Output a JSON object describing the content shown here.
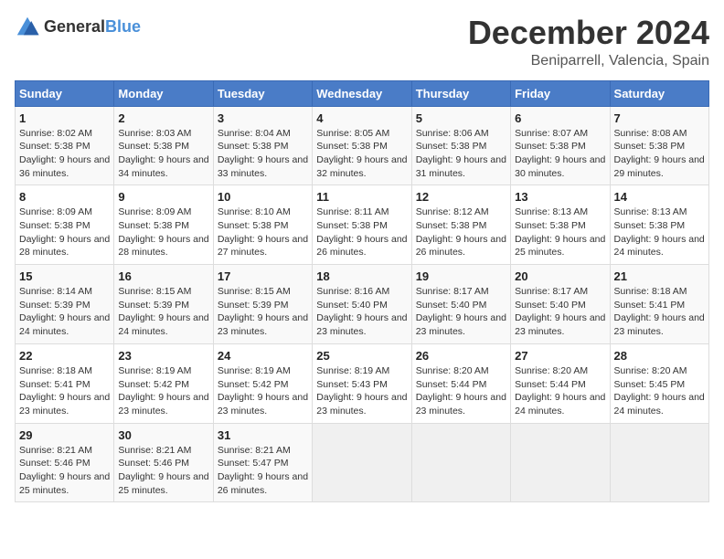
{
  "logo": {
    "text_general": "General",
    "text_blue": "Blue"
  },
  "title": "December 2024",
  "location": "Beniparrell, Valencia, Spain",
  "days_of_week": [
    "Sunday",
    "Monday",
    "Tuesday",
    "Wednesday",
    "Thursday",
    "Friday",
    "Saturday"
  ],
  "weeks": [
    [
      {
        "day": "1",
        "sunrise": "8:02 AM",
        "sunset": "5:38 PM",
        "daylight": "9 hours and 36 minutes."
      },
      {
        "day": "2",
        "sunrise": "8:03 AM",
        "sunset": "5:38 PM",
        "daylight": "9 hours and 34 minutes."
      },
      {
        "day": "3",
        "sunrise": "8:04 AM",
        "sunset": "5:38 PM",
        "daylight": "9 hours and 33 minutes."
      },
      {
        "day": "4",
        "sunrise": "8:05 AM",
        "sunset": "5:38 PM",
        "daylight": "9 hours and 32 minutes."
      },
      {
        "day": "5",
        "sunrise": "8:06 AM",
        "sunset": "5:38 PM",
        "daylight": "9 hours and 31 minutes."
      },
      {
        "day": "6",
        "sunrise": "8:07 AM",
        "sunset": "5:38 PM",
        "daylight": "9 hours and 30 minutes."
      },
      {
        "day": "7",
        "sunrise": "8:08 AM",
        "sunset": "5:38 PM",
        "daylight": "9 hours and 29 minutes."
      }
    ],
    [
      {
        "day": "8",
        "sunrise": "8:09 AM",
        "sunset": "5:38 PM",
        "daylight": "9 hours and 28 minutes."
      },
      {
        "day": "9",
        "sunrise": "8:09 AM",
        "sunset": "5:38 PM",
        "daylight": "9 hours and 28 minutes."
      },
      {
        "day": "10",
        "sunrise": "8:10 AM",
        "sunset": "5:38 PM",
        "daylight": "9 hours and 27 minutes."
      },
      {
        "day": "11",
        "sunrise": "8:11 AM",
        "sunset": "5:38 PM",
        "daylight": "9 hours and 26 minutes."
      },
      {
        "day": "12",
        "sunrise": "8:12 AM",
        "sunset": "5:38 PM",
        "daylight": "9 hours and 26 minutes."
      },
      {
        "day": "13",
        "sunrise": "8:13 AM",
        "sunset": "5:38 PM",
        "daylight": "9 hours and 25 minutes."
      },
      {
        "day": "14",
        "sunrise": "8:13 AM",
        "sunset": "5:38 PM",
        "daylight": "9 hours and 24 minutes."
      }
    ],
    [
      {
        "day": "15",
        "sunrise": "8:14 AM",
        "sunset": "5:39 PM",
        "daylight": "9 hours and 24 minutes."
      },
      {
        "day": "16",
        "sunrise": "8:15 AM",
        "sunset": "5:39 PM",
        "daylight": "9 hours and 24 minutes."
      },
      {
        "day": "17",
        "sunrise": "8:15 AM",
        "sunset": "5:39 PM",
        "daylight": "9 hours and 23 minutes."
      },
      {
        "day": "18",
        "sunrise": "8:16 AM",
        "sunset": "5:40 PM",
        "daylight": "9 hours and 23 minutes."
      },
      {
        "day": "19",
        "sunrise": "8:17 AM",
        "sunset": "5:40 PM",
        "daylight": "9 hours and 23 minutes."
      },
      {
        "day": "20",
        "sunrise": "8:17 AM",
        "sunset": "5:40 PM",
        "daylight": "9 hours and 23 minutes."
      },
      {
        "day": "21",
        "sunrise": "8:18 AM",
        "sunset": "5:41 PM",
        "daylight": "9 hours and 23 minutes."
      }
    ],
    [
      {
        "day": "22",
        "sunrise": "8:18 AM",
        "sunset": "5:41 PM",
        "daylight": "9 hours and 23 minutes."
      },
      {
        "day": "23",
        "sunrise": "8:19 AM",
        "sunset": "5:42 PM",
        "daylight": "9 hours and 23 minutes."
      },
      {
        "day": "24",
        "sunrise": "8:19 AM",
        "sunset": "5:42 PM",
        "daylight": "9 hours and 23 minutes."
      },
      {
        "day": "25",
        "sunrise": "8:19 AM",
        "sunset": "5:43 PM",
        "daylight": "9 hours and 23 minutes."
      },
      {
        "day": "26",
        "sunrise": "8:20 AM",
        "sunset": "5:44 PM",
        "daylight": "9 hours and 23 minutes."
      },
      {
        "day": "27",
        "sunrise": "8:20 AM",
        "sunset": "5:44 PM",
        "daylight": "9 hours and 24 minutes."
      },
      {
        "day": "28",
        "sunrise": "8:20 AM",
        "sunset": "5:45 PM",
        "daylight": "9 hours and 24 minutes."
      }
    ],
    [
      {
        "day": "29",
        "sunrise": "8:21 AM",
        "sunset": "5:46 PM",
        "daylight": "9 hours and 25 minutes."
      },
      {
        "day": "30",
        "sunrise": "8:21 AM",
        "sunset": "5:46 PM",
        "daylight": "9 hours and 25 minutes."
      },
      {
        "day": "31",
        "sunrise": "8:21 AM",
        "sunset": "5:47 PM",
        "daylight": "9 hours and 26 minutes."
      },
      null,
      null,
      null,
      null
    ]
  ]
}
